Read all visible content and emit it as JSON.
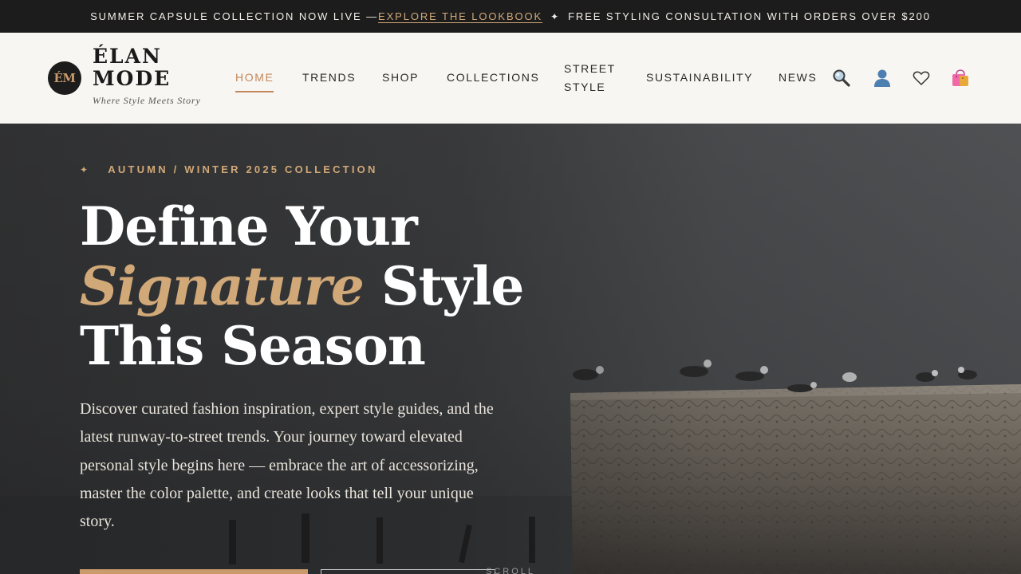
{
  "announcement": {
    "text_before": "SUMMER CAPSULE COLLECTION NOW LIVE — ",
    "link": "EXPLORE THE LOOKBOOK",
    "separator": "✦",
    "text_after": "FREE STYLING CONSULTATION WITH ORDERS OVER $200"
  },
  "brand": {
    "mark": "ÉM",
    "name_line1": "ÉLAN",
    "name_line2": "MODE",
    "tagline": "Where Style Meets Story"
  },
  "nav": {
    "home": "HOME",
    "trends": "TRENDS",
    "shop": "SHOP",
    "collections": "COLLECTIONS",
    "street_line1": "STREET",
    "street_line2": "STYLE",
    "sustainability": "SUSTAINABILITY",
    "news": "NEWS",
    "active": "HOME"
  },
  "header_icons": [
    "search-icon",
    "account-icon",
    "wishlist-heart-icon",
    "shopping-bag-icon"
  ],
  "hero": {
    "eyebrow_icon": "✦",
    "eyebrow": "AUTUMN / WINTER 2025 COLLECTION",
    "headline_line1": "Define Your",
    "headline_accent": "Signature",
    "headline_line2_rest": " Style",
    "headline_line3": "This Season",
    "lede": "Discover curated fashion inspiration, expert style guides, and the latest runway-to-street trends. Your journey toward elevated personal style begins here — embrace the art of accessorizing, master the color palette, and create looks that tell your unique story.",
    "scroll_label": "SCROLL"
  },
  "colors": {
    "accent": "#c99a6b",
    "accent_text": "#d1a878",
    "dark": "#1c1c1c",
    "header_bg": "#f8f6f2"
  }
}
